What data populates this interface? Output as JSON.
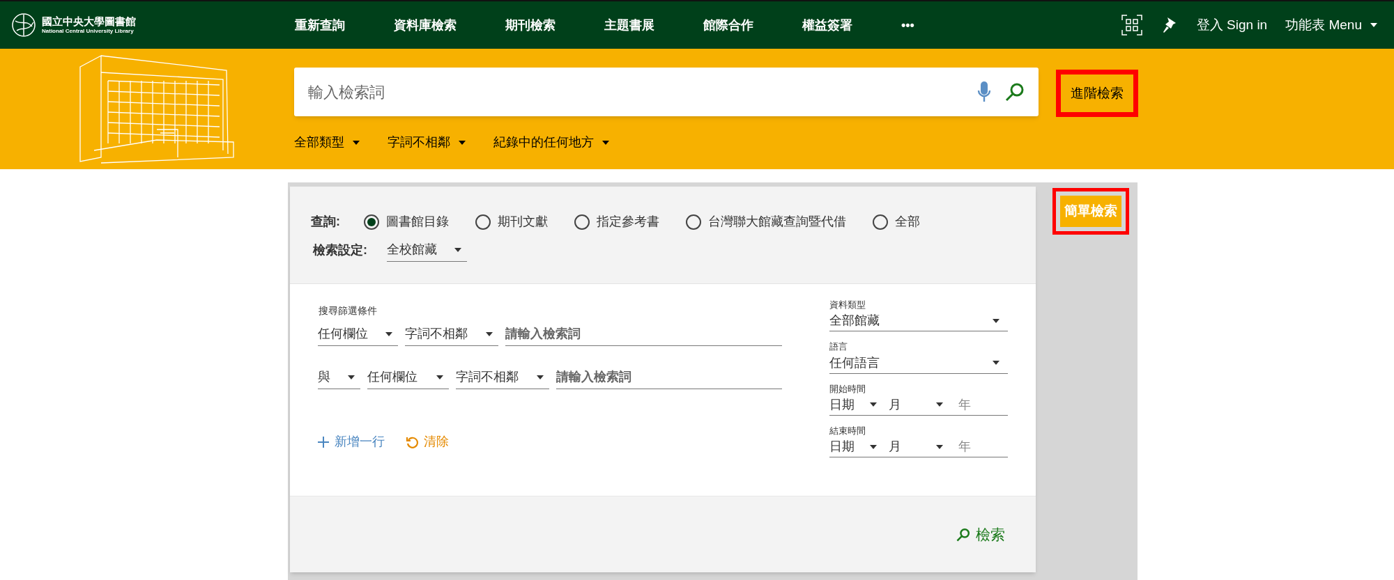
{
  "header": {
    "logo": {
      "title": "國立中央大學圖書館",
      "subtitle": "National Central University Library"
    },
    "nav": [
      "重新查詢",
      "資料庫檢索",
      "期刊檢索",
      "主題書展",
      "館際合作",
      "權益簽署",
      "•••"
    ],
    "sign_in": "登入 Sign in",
    "menu": "功能表 Menu"
  },
  "search": {
    "placeholder": "輸入檢索詞",
    "advanced": "進階檢索",
    "highlighted": true,
    "dropdowns": [
      "全部類型",
      "字詞不相鄰",
      "紀錄中的任何地方"
    ]
  },
  "simple_search": {
    "label": "簡單檢索",
    "highlighted": true
  },
  "form": {
    "query_label": "查詢:",
    "scopes": [
      {
        "label": "圖書館目錄",
        "selected": true
      },
      {
        "label": "期刊文獻",
        "selected": false
      },
      {
        "label": "指定參考書",
        "selected": false
      },
      {
        "label": "台灣聯大館藏查詢暨代借",
        "selected": false
      },
      {
        "label": "全部",
        "selected": false
      }
    ],
    "setting_label": "檢索設定:",
    "setting_value": "全校館藏",
    "criteria_title": "搜尋篩選條件",
    "rows": [
      {
        "field": "任何欄位",
        "match": "字詞不相鄰",
        "placeholder": "請輸入檢索詞"
      },
      {
        "operator": "與",
        "field": "任何欄位",
        "match": "字詞不相鄰",
        "placeholder": "請輸入檢索詞"
      }
    ],
    "add_row": "新增一行",
    "clear": "清除",
    "filters": [
      {
        "kind": "select",
        "label": "資料類型",
        "value": "全部館藏"
      },
      {
        "kind": "select",
        "label": "語言",
        "value": "任何語言"
      },
      {
        "kind": "date",
        "label": "開始時間",
        "day": "日期",
        "month": "月",
        "year": "年"
      },
      {
        "kind": "date",
        "label": "結束時間",
        "day": "日期",
        "month": "月",
        "year": "年"
      }
    ],
    "submit": "檢索"
  }
}
